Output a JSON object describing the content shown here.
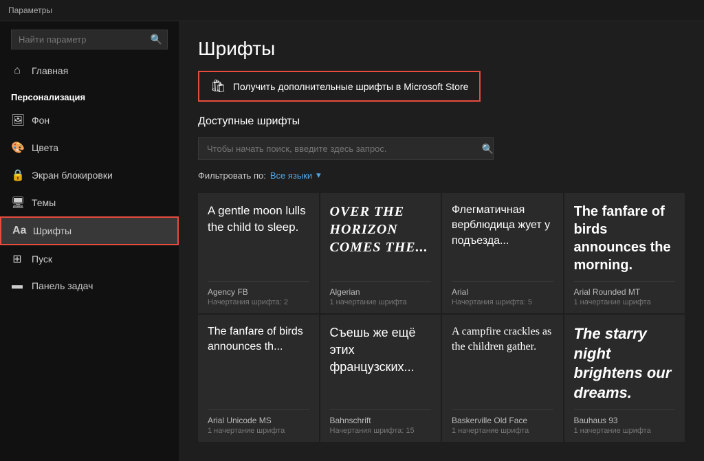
{
  "titleBar": {
    "label": "Параметры"
  },
  "sidebar": {
    "searchPlaceholder": "Найти параметр",
    "homeLabel": "Главная",
    "sectionLabel": "Персонализация",
    "navItems": [
      {
        "id": "background",
        "label": "Фон",
        "icon": "🖼"
      },
      {
        "id": "colors",
        "label": "Цвета",
        "icon": "🎨"
      },
      {
        "id": "lockscreen",
        "label": "Экран блокировки",
        "icon": "🔒"
      },
      {
        "id": "themes",
        "label": "Темы",
        "icon": "🖥"
      },
      {
        "id": "fonts",
        "label": "Шрифты",
        "icon": "A"
      },
      {
        "id": "start",
        "label": "Пуск",
        "icon": "⊞"
      },
      {
        "id": "taskbar",
        "label": "Панель задач",
        "icon": "▬"
      }
    ]
  },
  "content": {
    "pageTitle": "Шрифты",
    "storeButton": "Получить дополнительные шрифты в Microsoft Store",
    "availableFontsLabel": "Доступные шрифты",
    "searchPlaceholder": "Чтобы начать поиск, введите здесь запрос.",
    "filterLabel": "Фильтровать по:",
    "filterValue": "Все языки",
    "fontCards": [
      {
        "id": "agency-fb",
        "preview": "A gentle moon lulls the child to sleep.",
        "previewStyle": "agency",
        "fontName": "Agency FB",
        "variantsLabel": "Начертания шрифта: 2"
      },
      {
        "id": "algerian",
        "preview": "OVER THE HORIZON COMES THE...",
        "previewStyle": "algerian",
        "fontName": "Algerian",
        "variantsLabel": "1 начертание шрифта"
      },
      {
        "id": "arial",
        "preview": "Флегматичная верблюдица жует у подъезда...",
        "previewStyle": "arial",
        "fontName": "Arial",
        "variantsLabel": "Начертания шрифта: 5"
      },
      {
        "id": "arial-rounded",
        "preview": "The fanfare of birds announces the morning.",
        "previewStyle": "arial-rounded",
        "fontName": "Arial Rounded MT",
        "variantsLabel": "1 начертание шрифта"
      },
      {
        "id": "arial-unicode",
        "preview": "The fanfare of birds announces th...",
        "previewStyle": "arial-unicode",
        "fontName": "Arial Unicode MS",
        "variantsLabel": "1 начертание шрифта"
      },
      {
        "id": "bahnschrift",
        "preview": "Съешь же ещё этих французских...",
        "previewStyle": "bahnschrift",
        "fontName": "Bahnschrift",
        "variantsLabel": "Начертания шрифта: 15"
      },
      {
        "id": "baskerville",
        "preview": "A campfire crackles as the children gather.",
        "previewStyle": "baskerville",
        "fontName": "Baskerville Old Face",
        "variantsLabel": "1 начертание шрифта"
      },
      {
        "id": "bauhaus",
        "preview": "The starry night brightens our dreams.",
        "previewStyle": "bauhaus",
        "fontName": "Bauhaus 93",
        "variantsLabel": "1 начертание шрифта"
      }
    ]
  }
}
